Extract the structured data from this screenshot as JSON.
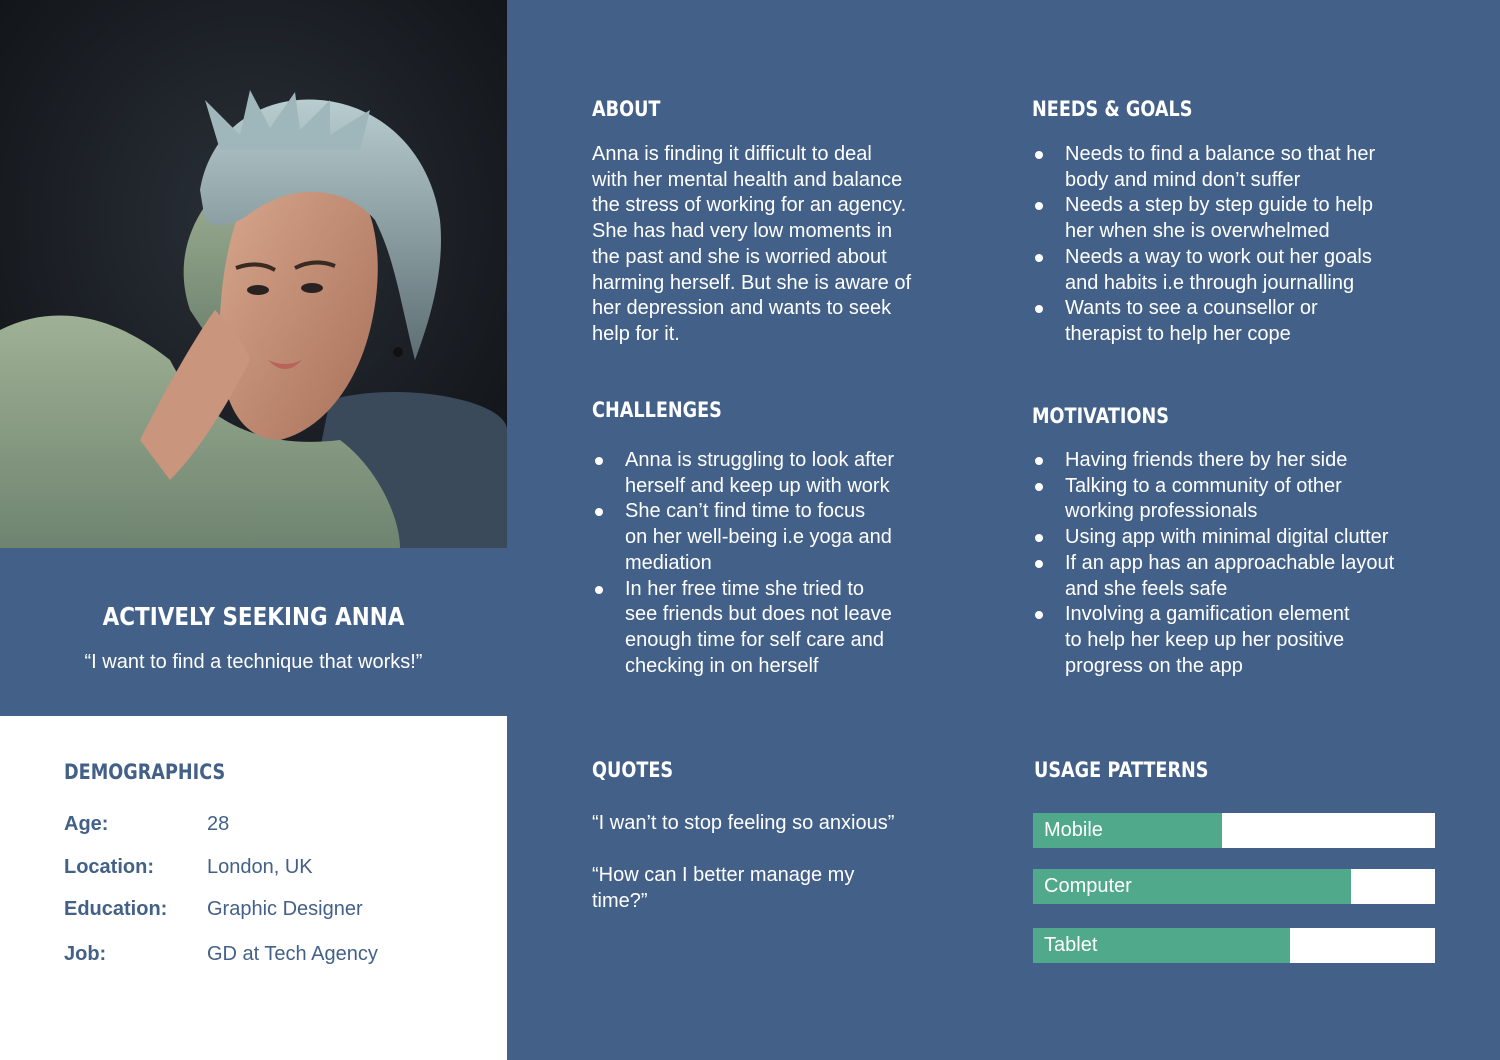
{
  "persona": {
    "name": "ACTIVELY SEEKING ANNA",
    "quote": "“I want to find a technique that works!”"
  },
  "demographics": {
    "heading": "DEMOGRAPHICS",
    "rows": [
      {
        "label": "Age:",
        "value": "28"
      },
      {
        "label": "Location:",
        "value": "London, UK"
      },
      {
        "label": "Education:",
        "value": "Graphic Designer"
      },
      {
        "label": "Job:",
        "value": "GD at Tech Agency"
      }
    ]
  },
  "about": {
    "heading": "ABOUT",
    "lines": [
      "Anna is finding it difficult to deal",
      "with her mental health and balance",
      "the stress of working for an agency.",
      "She has had very low moments in",
      "the past and she is worried about",
      "harming herself. But she is aware of",
      "her depression and wants to seek",
      "help for it."
    ]
  },
  "needs_goals": {
    "heading": "NEEDS & GOALS",
    "items": [
      [
        "Needs to find a balance so that her",
        "body and mind don’t suffer"
      ],
      [
        "Needs a step by step guide to help",
        "her when she is overwhelmed"
      ],
      [
        "Needs a way to work out her goals",
        "and habits i.e through journalling"
      ],
      [
        "Wants to see a counsellor or",
        "therapist to help her cope"
      ]
    ]
  },
  "challenges": {
    "heading": "CHALLENGES",
    "items": [
      [
        "Anna is struggling to look after",
        "herself and keep up with work"
      ],
      [
        "She can’t find time to focus",
        "on her well-being i.e yoga and",
        "mediation"
      ],
      [
        "In her free time she tried to",
        "see friends but does not leave",
        "enough time for self care and",
        "checking in on herself"
      ]
    ]
  },
  "motivations": {
    "heading": "MOTIVATIONS",
    "items": [
      [
        "Having friends there by her side"
      ],
      [
        "Talking to a community of other",
        "working professionals"
      ],
      [
        "Using app with minimal digital clutter"
      ],
      [
        "If an app has an approachable layout",
        "and she feels safe"
      ],
      [
        "Involving a gamification element",
        "to help her keep up her positive",
        "progress on the app"
      ]
    ]
  },
  "quotes": {
    "heading": "QUOTES",
    "items": [
      [
        "“I wan’t to stop feeling so anxious”"
      ],
      [
        "“How can I better manage my",
        "time?”"
      ]
    ]
  },
  "usage": {
    "heading": "USAGE PATTERNS",
    "bars": [
      {
        "label": "Mobile",
        "level": 0.47
      },
      {
        "label": "Computer",
        "level": 0.79
      },
      {
        "label": "Tablet",
        "level": 0.64
      }
    ]
  },
  "colors": {
    "background": "#436188",
    "accent": "#4fa98a",
    "panel": "#ffffff"
  }
}
